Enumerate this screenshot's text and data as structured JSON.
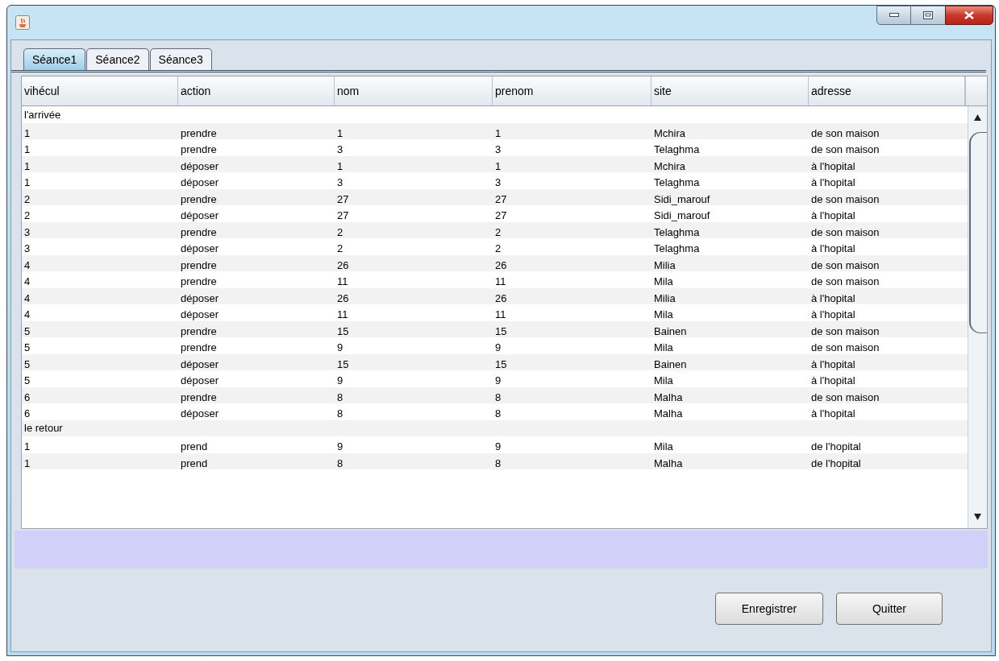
{
  "tabs": [
    {
      "label": "Séance1",
      "selected": true
    },
    {
      "label": "Séance2",
      "selected": false
    },
    {
      "label": "Séance3",
      "selected": false
    }
  ],
  "table": {
    "columns": [
      "vihécul",
      "action",
      "nom",
      "prenom",
      "site",
      "adresse"
    ],
    "rows": [
      {
        "kind": "section",
        "label": "l'arrivée"
      },
      {
        "kind": "data",
        "cells": [
          "1",
          "prendre",
          "1",
          "1",
          "Mchira",
          "de son maison"
        ]
      },
      {
        "kind": "data",
        "cells": [
          "1",
          "prendre",
          "3",
          "3",
          "Telaghma",
          "de son maison"
        ]
      },
      {
        "kind": "data",
        "cells": [
          "1",
          "déposer",
          "1",
          "1",
          "Mchira",
          "à l'hopital"
        ]
      },
      {
        "kind": "data",
        "cells": [
          "1",
          "déposer",
          "3",
          "3",
          "Telaghma",
          "à l'hopital"
        ]
      },
      {
        "kind": "data",
        "cells": [
          "2",
          "prendre",
          "27",
          "27",
          "Sidi_marouf",
          "de son maison"
        ]
      },
      {
        "kind": "data",
        "cells": [
          "2",
          "déposer",
          "27",
          "27",
          "Sidi_marouf",
          "à l'hopital"
        ]
      },
      {
        "kind": "data",
        "cells": [
          "3",
          "prendre",
          "2",
          "2",
          "Telaghma",
          "de son maison"
        ]
      },
      {
        "kind": "data",
        "cells": [
          "3",
          "déposer",
          "2",
          "2",
          "Telaghma",
          "à l'hopital"
        ]
      },
      {
        "kind": "data",
        "cells": [
          "4",
          "prendre",
          "26",
          "26",
          "Milia",
          "de son maison"
        ]
      },
      {
        "kind": "data",
        "cells": [
          "4",
          "prendre",
          "11",
          "11",
          "Mila",
          "de son maison"
        ]
      },
      {
        "kind": "data",
        "cells": [
          "4",
          "déposer",
          "26",
          "26",
          "Milia",
          "à l'hopital"
        ]
      },
      {
        "kind": "data",
        "cells": [
          "4",
          "déposer",
          "11",
          "11",
          "Mila",
          "à l'hopital"
        ]
      },
      {
        "kind": "data",
        "cells": [
          "5",
          "prendre",
          "15",
          "15",
          "Bainen",
          "de son maison"
        ]
      },
      {
        "kind": "data",
        "cells": [
          "5",
          "prendre",
          "9",
          "9",
          "Mila",
          "de son maison"
        ]
      },
      {
        "kind": "data",
        "cells": [
          "5",
          "déposer",
          "15",
          "15",
          "Bainen",
          "à l'hopital"
        ]
      },
      {
        "kind": "data",
        "cells": [
          "5",
          "déposer",
          "9",
          "9",
          "Mila",
          "à l'hopital"
        ]
      },
      {
        "kind": "data",
        "cells": [
          "6",
          "prendre",
          "8",
          "8",
          "Malha",
          "de son maison"
        ]
      },
      {
        "kind": "data",
        "cells": [
          "6",
          "déposer",
          "8",
          "8",
          "Malha",
          "à l'hopital"
        ]
      },
      {
        "kind": "section",
        "label": "le retour"
      },
      {
        "kind": "data",
        "cells": [
          "1",
          "prend",
          "9",
          "9",
          "Mila",
          "de l'hopital"
        ]
      },
      {
        "kind": "data",
        "cells": [
          "1",
          "prend",
          "8",
          "8",
          "Malha",
          "de l'hopital"
        ]
      }
    ]
  },
  "buttons": [
    "Enregistrer",
    "Quitter"
  ]
}
